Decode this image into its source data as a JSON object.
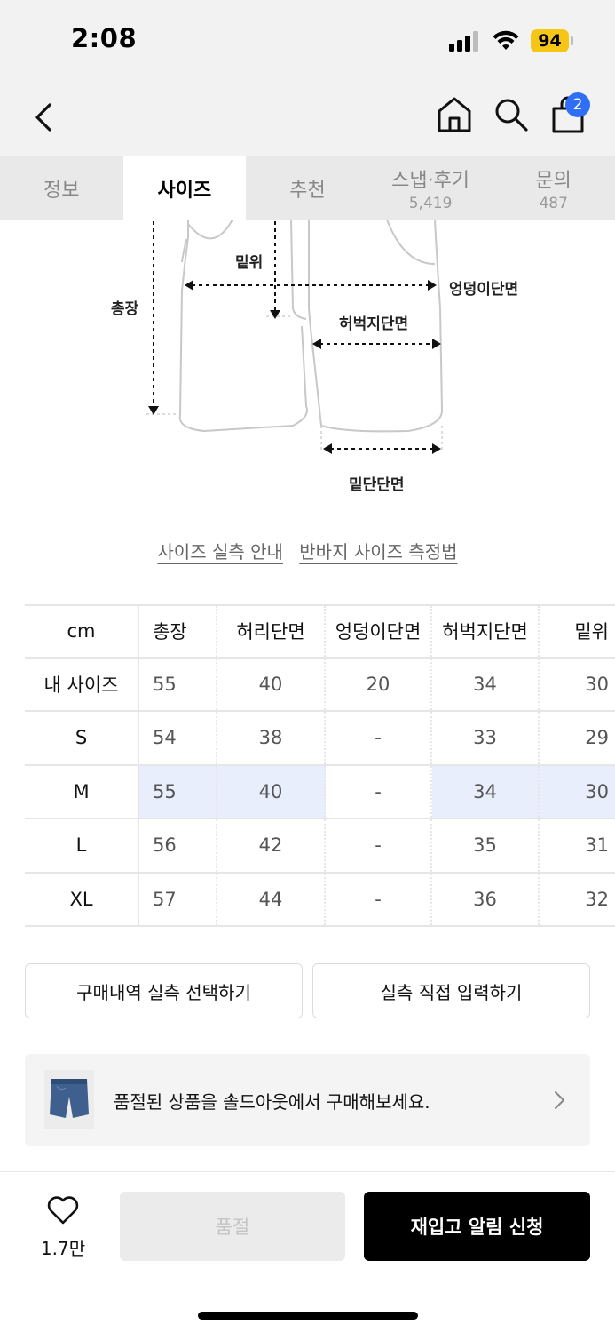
{
  "status_bar": {
    "time": "2:08",
    "battery": "94",
    "battery_color": "#f5c518"
  },
  "nav": {
    "back_icon": "chevron-left-icon",
    "home_icon": "home-icon",
    "search_icon": "search-icon",
    "cart_icon": "shopping-bag-icon",
    "cart_badge": "2",
    "badge_color": "#2f6ff7"
  },
  "tabs": [
    {
      "label": "정보",
      "count": ""
    },
    {
      "label": "사이즈",
      "count": ""
    },
    {
      "label": "추천",
      "count": ""
    },
    {
      "label": "스냅·후기",
      "count": "5,419"
    },
    {
      "label": "문의",
      "count": "487"
    }
  ],
  "diagram": {
    "labels": {
      "rise": "밑위",
      "length": "총장",
      "hip": "엉덩이단면",
      "thigh": "허벅지단면",
      "hem": "밑단단면"
    }
  },
  "guide_links": {
    "size_guide": "사이즈 실측 안내",
    "measure_method": "반바지 사이즈 측정법"
  },
  "size_table": {
    "headers": [
      "cm",
      "총장",
      "허리단면",
      "엉덩이단면",
      "허벅지단면",
      "밑위"
    ],
    "rows": [
      {
        "label": "내 사이즈",
        "values": [
          "55",
          "40",
          "20",
          "34",
          "30"
        ]
      },
      {
        "label": "S",
        "values": [
          "54",
          "38",
          "-",
          "33",
          "29"
        ]
      },
      {
        "label": "M",
        "values": [
          "55",
          "40",
          "-",
          "34",
          "30"
        ]
      },
      {
        "label": "L",
        "values": [
          "56",
          "42",
          "-",
          "35",
          "31"
        ]
      },
      {
        "label": "XL",
        "values": [
          "57",
          "44",
          "-",
          "36",
          "32"
        ]
      }
    ],
    "highlight_color": "#e8eefc"
  },
  "actions": {
    "select_purchase": "구매내역 실측 선택하기",
    "manual_input": "실측 직접 입력하기"
  },
  "soldout_banner": {
    "text": "품절된 상품을 솔드아웃에서 구매해보세요.",
    "thumb_icon": "denim-shorts-thumbnail"
  },
  "bottom_bar": {
    "like_icon": "heart-icon",
    "like_count": "1.7만",
    "soldout_label": "품절",
    "restock_label": "재입고 알림 신청"
  }
}
